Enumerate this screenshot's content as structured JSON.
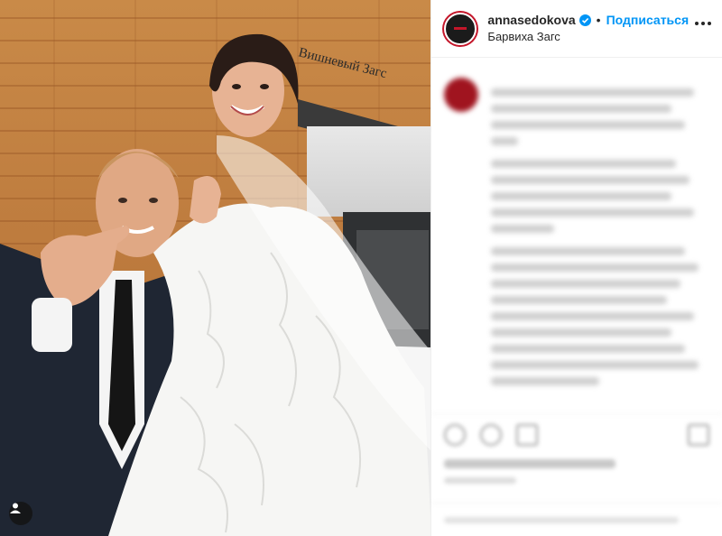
{
  "header": {
    "username": "annasedokova",
    "follow_label": "Подписаться",
    "separator": "•",
    "location": "Барвиха Загс"
  },
  "photo": {
    "sign_text": "Вишневый Загс",
    "tag_icon": "user-tag-icon"
  },
  "colors": {
    "accent": "#0095f6",
    "avatar_ring": "#c4162a",
    "text": "#262626"
  }
}
